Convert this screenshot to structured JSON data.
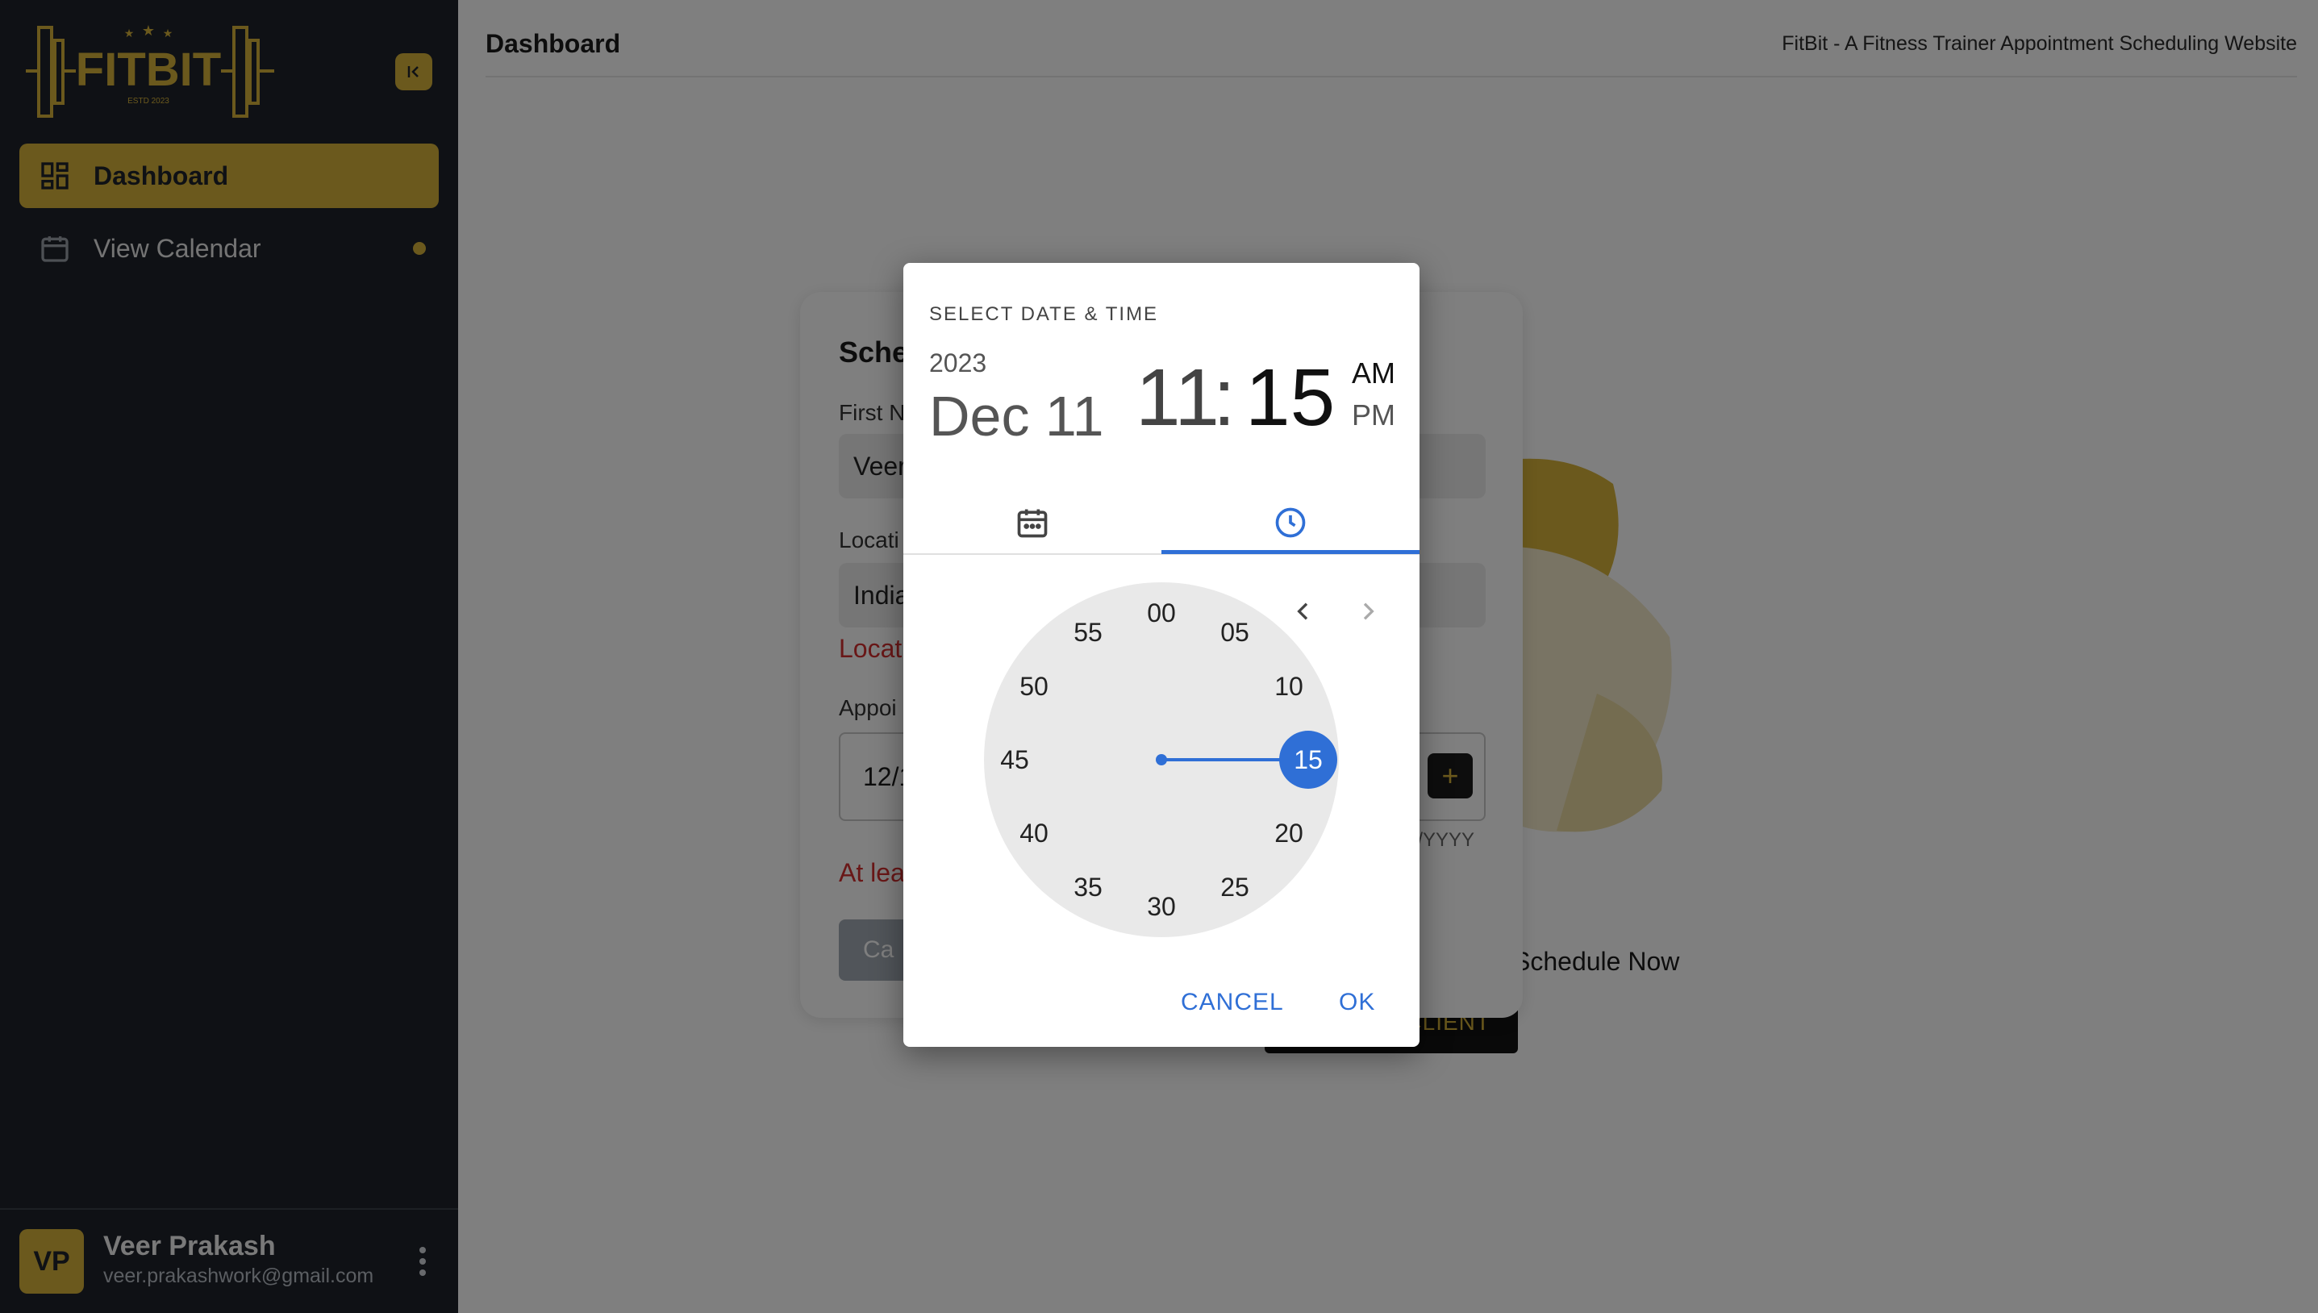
{
  "sidebar": {
    "collapse_icon": "collapse-left-icon",
    "items": [
      {
        "label": "Dashboard",
        "icon": "dashboard-grid-icon",
        "active": true
      },
      {
        "label": "View Calendar",
        "icon": "calendar-icon",
        "active": false
      }
    ],
    "user": {
      "initials": "VP",
      "name": "Veer Prakash",
      "email": "veer.prakashwork@gmail.com"
    }
  },
  "header": {
    "title": "Dashboard",
    "site_title": "FitBit - A Fitness Trainer Appointment Scheduling Website"
  },
  "background": {
    "form": {
      "title": "Sche",
      "first_name_label": "First N",
      "first_name_value": "Veer",
      "location_label": "Locati",
      "location_value": "India",
      "location_error": "Locat",
      "appointment_label": "Appoi",
      "appointment_value": "12/1",
      "date_hint": "D/YYYY",
      "add_symbol": "+",
      "error_text": "At lea",
      "cancel_label": "Ca"
    },
    "schedule_now": "Schedule Now",
    "add_client_label": "CLIENT"
  },
  "picker": {
    "heading": "SELECT DATE & TIME",
    "year": "2023",
    "date": "Dec 11",
    "hour": "11",
    "separator": ":",
    "minute": "15",
    "am": "AM",
    "pm": "PM",
    "selected_period": "AM",
    "active_tab": "time",
    "clock": {
      "selected": "15",
      "numbers": [
        "00",
        "05",
        "10",
        "15",
        "20",
        "25",
        "30",
        "35",
        "40",
        "45",
        "50",
        "55"
      ]
    },
    "cancel_label": "CANCEL",
    "ok_label": "OK"
  },
  "colors": {
    "sidebar_bg": "#1e232b",
    "accent_gold": "#d6b23a",
    "picker_blue": "#2f6fd6",
    "error_red": "#d32f2f"
  }
}
